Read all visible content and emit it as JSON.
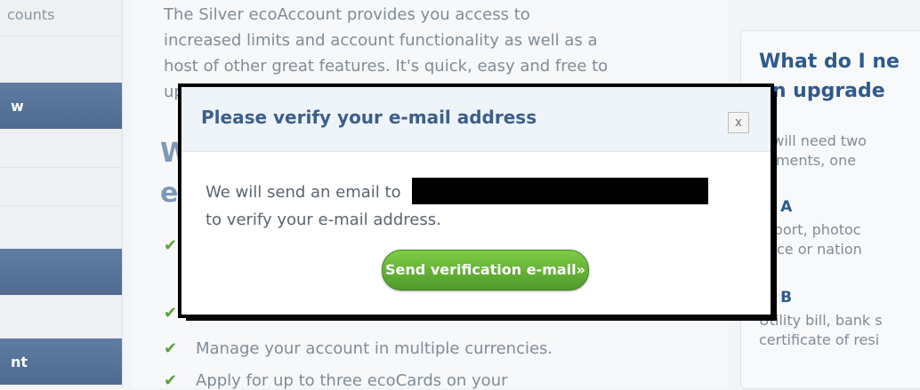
{
  "sidebar": {
    "top_link": "counts",
    "buttons": [
      "w",
      "nt"
    ]
  },
  "main": {
    "intro_lines": [
      "The Silver ecoAccount provides you access to",
      "increased limits and account functionality as well as a",
      "host of other great features. It's quick, easy and free to",
      "up"
    ],
    "heading_lines": [
      "W",
      "e"
    ],
    "features": [
      "",
      "",
      "Manage your account in multiple currencies.",
      "Apply for up to three ecoCards on your"
    ]
  },
  "panel": {
    "title": [
      "What do I ne",
      "an upgrade"
    ],
    "text": [
      "u will need two",
      "cuments, one"
    ],
    "list_a": "st A",
    "list_a_text": [
      "ssport, photoc",
      "ence or nation"
    ],
    "list_b": "st B",
    "list_b_text": [
      "Utility bill, bank s",
      "certificate of resi"
    ]
  },
  "modal": {
    "title": "Please verify your e-mail address",
    "close_label": "x",
    "line1": "We will send an email to",
    "line2": "to verify your e-mail address.",
    "button": "Send verification e-mail»"
  }
}
